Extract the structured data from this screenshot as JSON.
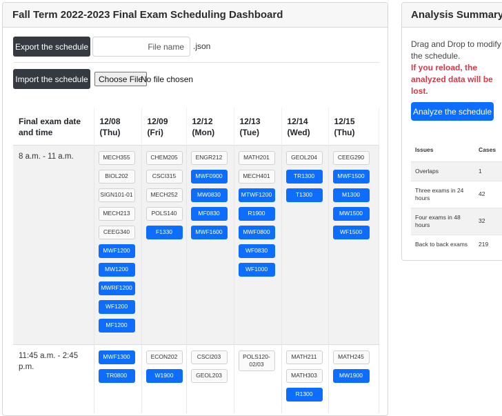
{
  "dashboard": {
    "title": "Fall Term 2022-2023 Final Exam Scheduling Dashboard",
    "export_button": "Export the schedule",
    "file_name_placeholder": "File name",
    "file_extension": ".json",
    "import_button": "Import the schedule",
    "choose_file_button": "Choose File",
    "no_file_text": "No file chosen"
  },
  "schedule": {
    "time_header": "Final exam date and time",
    "days": [
      {
        "date": "12/08",
        "weekday": "(Thu)"
      },
      {
        "date": "12/09",
        "weekday": "(Fri)"
      },
      {
        "date": "12/12",
        "weekday": "(Mon)"
      },
      {
        "date": "12/13",
        "weekday": "(Tue)"
      },
      {
        "date": "12/14",
        "weekday": "(Wed)"
      },
      {
        "date": "12/15",
        "weekday": "(Thu)"
      }
    ],
    "slots": [
      {
        "time": "8 a.m. - 11 a.m.",
        "cells": [
          [
            {
              "label": "MECH355",
              "style": "light"
            },
            {
              "label": "BIOL202",
              "style": "light"
            },
            {
              "label": "SIGN101-01",
              "style": "light"
            },
            {
              "label": "MECH213",
              "style": "light"
            },
            {
              "label": "CEEG340",
              "style": "light"
            },
            {
              "label": "MWF1200",
              "style": "blue"
            },
            {
              "label": "MW1200",
              "style": "blue"
            },
            {
              "label": "MWRF1200",
              "style": "blue"
            },
            {
              "label": "WF1200",
              "style": "blue"
            },
            {
              "label": "MF1200",
              "style": "blue"
            }
          ],
          [
            {
              "label": "CHEM205",
              "style": "light"
            },
            {
              "label": "CSCI315",
              "style": "light"
            },
            {
              "label": "MECH252",
              "style": "light"
            },
            {
              "label": "POLS140",
              "style": "light"
            },
            {
              "label": "F1330",
              "style": "blue"
            }
          ],
          [
            {
              "label": "ENGR212",
              "style": "light"
            },
            {
              "label": "MWF0900",
              "style": "blue"
            },
            {
              "label": "MW0830",
              "style": "blue"
            },
            {
              "label": "MF0830",
              "style": "blue"
            },
            {
              "label": "MWF1600",
              "style": "blue"
            }
          ],
          [
            {
              "label": "MATH201",
              "style": "light"
            },
            {
              "label": "MECH401",
              "style": "light"
            },
            {
              "label": "MTWF1200",
              "style": "blue"
            },
            {
              "label": "R1900",
              "style": "blue"
            },
            {
              "label": "MWF0800",
              "style": "blue"
            },
            {
              "label": "WF0830",
              "style": "blue"
            },
            {
              "label": "WF1000",
              "style": "blue"
            }
          ],
          [
            {
              "label": "GEOL204",
              "style": "light"
            },
            {
              "label": "TR1300",
              "style": "blue"
            },
            {
              "label": "T1300",
              "style": "blue"
            }
          ],
          [
            {
              "label": "CEEG290",
              "style": "light"
            },
            {
              "label": "MWF1500",
              "style": "blue"
            },
            {
              "label": "M1300",
              "style": "blue"
            },
            {
              "label": "MW1500",
              "style": "blue"
            },
            {
              "label": "WF1500",
              "style": "blue"
            }
          ]
        ]
      },
      {
        "time": "11:45 a.m. - 2:45 p.m.",
        "cells": [
          [
            {
              "label": "MWF1300",
              "style": "blue"
            },
            {
              "label": "TR0800",
              "style": "blue"
            }
          ],
          [
            {
              "label": "ECON202",
              "style": "light"
            },
            {
              "label": "W1900",
              "style": "blue"
            }
          ],
          [
            {
              "label": "CSCI203",
              "style": "light"
            },
            {
              "label": "GEOL203",
              "style": "light"
            }
          ],
          [
            {
              "label": "POLS120-02/03",
              "style": "light",
              "tall": true
            }
          ],
          [
            {
              "label": "MATH211",
              "style": "light"
            },
            {
              "label": "MATH303",
              "style": "light"
            },
            {
              "label": "R1300",
              "style": "blue"
            }
          ],
          [
            {
              "label": "MATH245",
              "style": "light"
            },
            {
              "label": "MW1900",
              "style": "blue"
            }
          ]
        ]
      }
    ]
  },
  "analysis": {
    "title": "Analysis Summary",
    "instructions": "Drag and Drop to modify the schedule.",
    "warning": "If you reload, the analyzed data will be lost.",
    "analyze_button": "Analyze the schedule",
    "issues_header": "Issues",
    "cases_header": "Cases",
    "issues": [
      {
        "issue": "Overlaps",
        "cases": "1"
      },
      {
        "issue": "Three exams in 24 hours",
        "cases": "42"
      },
      {
        "issue": "Four exams in 48 hours",
        "cases": "32"
      },
      {
        "issue": "Back to back exams",
        "cases": "219"
      }
    ]
  },
  "colors": {
    "primary": "#0d6efd",
    "dark_button": "#343a40",
    "warning_text": "#dc3545"
  }
}
